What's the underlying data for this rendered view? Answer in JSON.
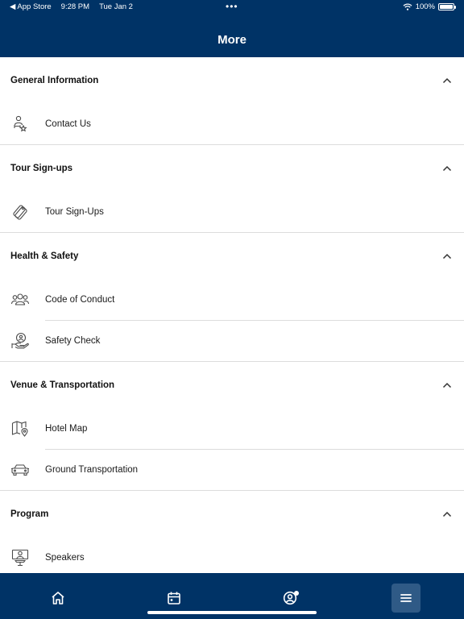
{
  "status_bar": {
    "back_app": "◀ App Store",
    "time": "9:28 PM",
    "date": "Tue Jan 2",
    "more_dots": "•••",
    "battery_text": "100%",
    "battery_level": 1.0
  },
  "header": {
    "title": "More"
  },
  "sections": [
    {
      "title": "General Information",
      "items": [
        {
          "label": "Contact Us",
          "icon": "contact-person-star-icon"
        }
      ]
    },
    {
      "title": "Tour Sign-ups",
      "items": [
        {
          "label": "Tour Sign-Ups",
          "icon": "tag-icon"
        }
      ]
    },
    {
      "title": "Health & Safety",
      "items": [
        {
          "label": "Code of Conduct",
          "icon": "people-group-icon"
        },
        {
          "label": "Safety Check",
          "icon": "hand-shield-icon"
        }
      ]
    },
    {
      "title": "Venue & Transportation",
      "items": [
        {
          "label": "Hotel Map",
          "icon": "map-pin-icon"
        },
        {
          "label": "Ground Transportation",
          "icon": "car-icon"
        }
      ]
    },
    {
      "title": "Program",
      "items": [
        {
          "label": "Speakers",
          "icon": "speaker-podium-icon"
        }
      ]
    }
  ],
  "tab_bar": {
    "tabs": [
      {
        "name": "home",
        "icon": "home-icon"
      },
      {
        "name": "schedule",
        "icon": "calendar-icon"
      },
      {
        "name": "profile",
        "icon": "user-circle-icon",
        "has_badge": true
      },
      {
        "name": "more",
        "icon": "menu-icon",
        "active": true
      }
    ]
  },
  "colors": {
    "nav": "#003366",
    "active_tab": "#2f5a86",
    "divider": "#dcdcdc",
    "icon": "#4a4a4a"
  }
}
